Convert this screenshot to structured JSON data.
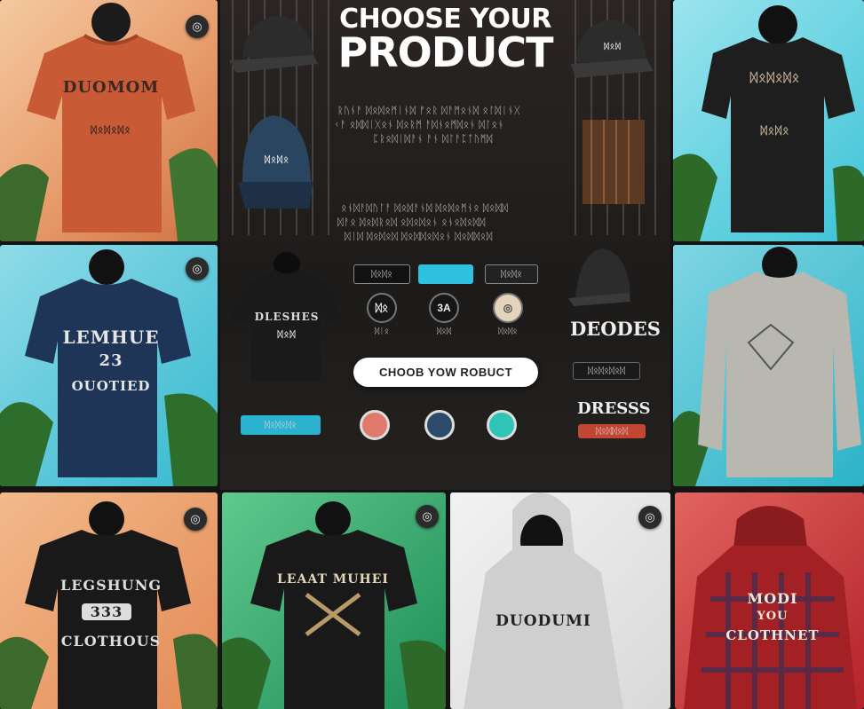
{
  "header": {
    "title_line1": "CHOOSE YOUR",
    "title_line2": "PRODUCT"
  },
  "intro_text": {
    "line1": "ᚱᚢᚾᚨ ᛞᛟᛞᛟᛗᛁᚾᛞ ᚠᛟᚱ ᛞᚨᛗᛟᚾᛞ ᛟᛚᛞᛁᚾᚷ",
    "line2": "ᚲᚨ ᛟᛞᛞᛁᚷᛟᚾ ᛞᛟᚱᛗ ᚨᛞᚾᛟᛗᛞᛟᚾ ᛞᛚᛟᚾ",
    "line3": "ᛈᚱᛟᛞᛁᛞᚨᚾ ᚨᚾ ᛞᛚᚨᛈᛏᚢᛗᛞ",
    "line4": "ᛟᚾᛞᚨᛞᚢᛚᚨ ᛞᛟᛞᚨᚾᛞ ᛞᛟᛞᛟᛗᚾᛟ ᛞᛟᛞᛞ",
    "line5": "ᛞᚨᛟ ᛞᛟᛞᚱᛟᛞ ᛟᛞᛟᛞᛟᚾ ᛟᚾᛟᛞᛟᛞᛞ",
    "line6": "ᛞᛁᛞ ᛞᛟᛞᛟᛞ ᛞᛟᛞᛞᛟᛞᛟᚾ ᛞᛟᛞᛞᛟᛞ"
  },
  "filters": {
    "pill1": "ᛞᛟᛞᛟ",
    "pill2": "",
    "pill3": "ᛞᛟᛞᛟ",
    "small_pill": "ᛞᛟᛞᛟᛞᛟ"
  },
  "size_buttons": [
    {
      "label": "ᛞᛟ",
      "caption": "ᛞᛁᛟ"
    },
    {
      "label": "3A",
      "caption": "ᛞᛟᛞ"
    },
    {
      "label": "◎",
      "caption": "ᛞᛟᛞᛟ"
    }
  ],
  "cta_label": "CHOOB YOW ROBUCT",
  "color_swatches": [
    {
      "name": "salmon",
      "color": "#e07a6c"
    },
    {
      "name": "navy",
      "color": "#2d4a6a"
    },
    {
      "name": "teal",
      "color": "#2ec4b6"
    }
  ],
  "side_labels": {
    "hoodies": "DEODES",
    "hoodies_sub": "ᛞᛟᛞᛟᛞᛟᛞ",
    "dresses": "DRESSS",
    "dresses_sub": "ᛞᛟᛞᛞᛟᛞ"
  },
  "center_shirt_print": {
    "line1": "DLESHES",
    "line2": "ᛞᛟᛞ"
  },
  "cap_prints": {
    "cap1": "",
    "cap2": "ᛞᛟᛞᛟ",
    "cap3": "ᛞᛟᛞ"
  },
  "products": [
    {
      "print1": "DUOMOM",
      "print2": "ᛞᛟᛞᛟᛞᛟ",
      "icon": "◎",
      "color": "#c85a35"
    },
    {
      "print1": "ᛞᛟᛞᛟᛞᛟ",
      "print2": "ᛞᛟᛞᛟ",
      "icon": "",
      "color": "#1e1e1e"
    },
    {
      "print1": "LEMHUE",
      "print2": "23",
      "print3": "OUOTIED",
      "icon": "◎",
      "color": "#1f3558"
    },
    {
      "print1": "",
      "print2": "",
      "icon": "",
      "color": "#b8b8b0"
    },
    {
      "print1": "LEGSHUNG",
      "print2": "333",
      "print3": "CLOTHOUS",
      "icon": "◎",
      "color": "#191919"
    },
    {
      "print1": "LEAAT MUHEI",
      "print2": "",
      "icon": "◎",
      "color": "#191919"
    },
    {
      "print1": "DUODUMI",
      "icon": "◎",
      "color": "#cfcfcf"
    },
    {
      "print1": "MODI",
      "print2": "YOU",
      "print3": "CLOTHNET",
      "icon": "",
      "color": "#a32125"
    }
  ]
}
